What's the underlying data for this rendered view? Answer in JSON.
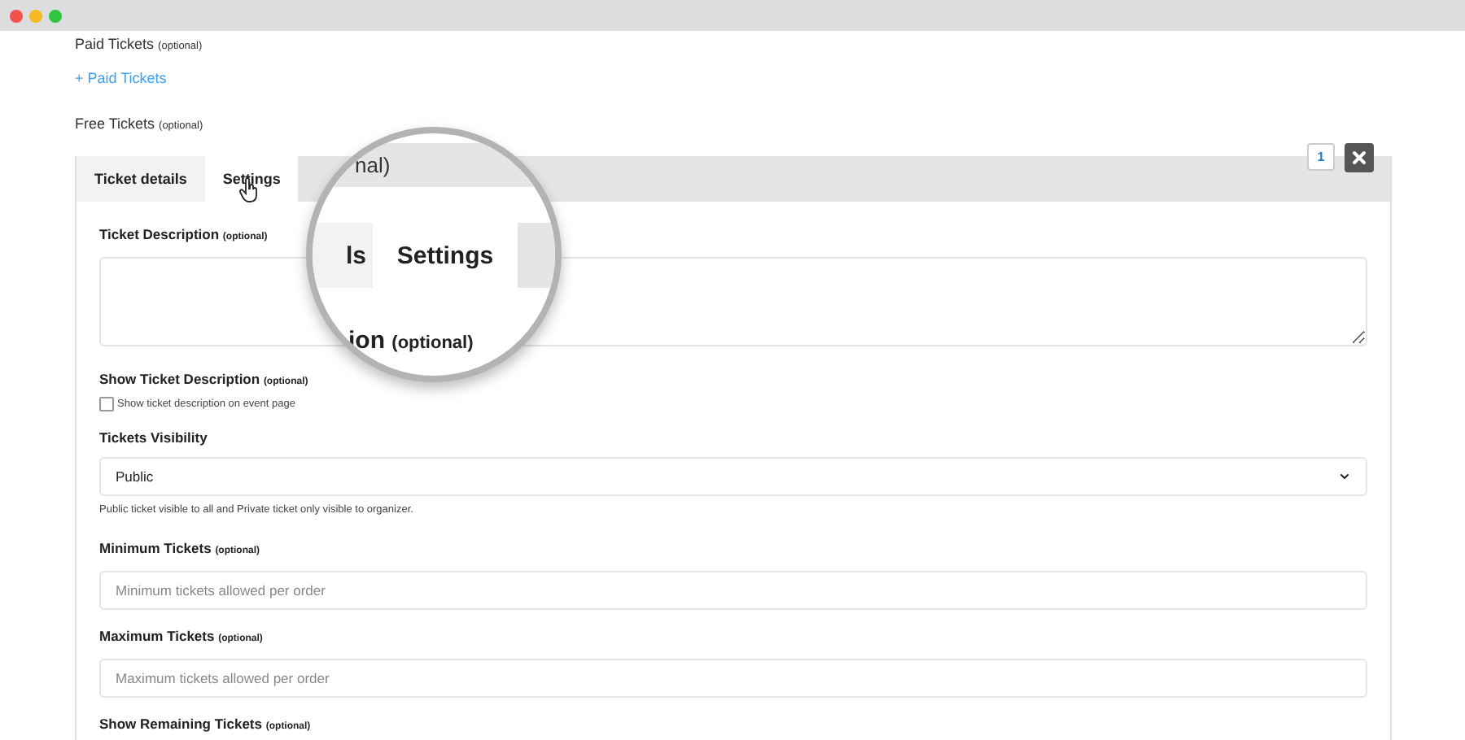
{
  "paid_tickets": {
    "label": "Paid Tickets",
    "hint": "(optional)",
    "link": "+ Paid Tickets"
  },
  "free_tickets": {
    "label": "Free Tickets",
    "hint": "(optional)"
  },
  "ticket_panel": {
    "count": "1",
    "tabs": [
      {
        "label": "Ticket details",
        "selected": false
      },
      {
        "label": "Settings",
        "selected": true
      }
    ],
    "fields": [
      {
        "kind": "textarea",
        "label": "Ticket Description",
        "hint": "(optional)"
      },
      {
        "kind": "checkbox",
        "label": "Show Ticket Description",
        "hint": "(optional)",
        "option": "Show ticket description on event page",
        "checked": false
      },
      {
        "kind": "select",
        "label": "Tickets Visibility",
        "value": "Public",
        "help": "Public ticket visible to all and Private ticket only visible to organizer."
      },
      {
        "kind": "input",
        "label": "Minimum Tickets",
        "hint": "(optional)",
        "placeholder": "Minimum tickets allowed per order"
      },
      {
        "kind": "input",
        "label": "Maximum Tickets",
        "hint": "(optional)",
        "placeholder": "Maximum tickets allowed per order"
      },
      {
        "kind": "heading",
        "label": "Show Remaining Tickets",
        "hint": "(optional)"
      }
    ]
  },
  "magnifier": {
    "header_text": "nal)",
    "tabs": [
      {
        "label": "ls",
        "selected": false
      },
      {
        "label": "Settings",
        "selected": true
      }
    ],
    "label": "ion",
    "hint": "(optional)"
  }
}
